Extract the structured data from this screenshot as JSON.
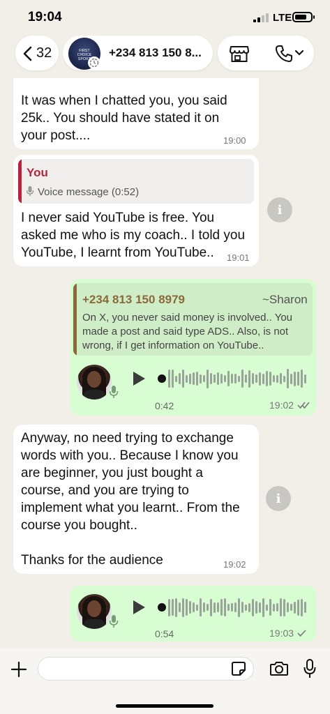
{
  "status": {
    "time": "19:04",
    "carrier": "LTE",
    "battery_level": 0.75
  },
  "header": {
    "back_count": "32",
    "contact_name": "+234 813 150 8...",
    "avatar_logo_text": "FIRST CHOICE SPORT"
  },
  "messages": [
    {
      "id": "m1",
      "direction": "incoming",
      "text": "It was when I chatted you, you said 25k.. You should have stated it on your post....",
      "lines": [
        "It was when I chatted you, you said",
        "25k.. You should have stated it on",
        "your post...."
      ],
      "time": "19:00"
    },
    {
      "id": "m2",
      "direction": "incoming",
      "quote": {
        "author": "You",
        "body": "Voice message (0:52)",
        "author_color": "#b5263c"
      },
      "lines": [
        "I never said YouTube is free. You",
        "asked me who is my coach.. I told you",
        "YouTube, I learnt from YouTube.."
      ],
      "time": "19:01"
    },
    {
      "id": "m3",
      "direction": "outgoing",
      "type": "voice",
      "quote": {
        "author": "+234 813 150 8979",
        "author_alias": "~Sharon",
        "author_color": "#8a6a3a",
        "lines": [
          "On X, you never said money is involved.. You",
          "made a post and said type ADS.. Also, is not",
          "wrong, if I get information on YouTube.."
        ]
      },
      "duration": "0:42",
      "time": "19:02",
      "status_icon": "double-check-icon"
    },
    {
      "id": "m4",
      "direction": "incoming",
      "lines": [
        "Anyway, no need trying to exchange",
        "words with you.. Because I know you",
        "are beginner, you just bought a",
        "course, and you are trying to",
        "implement what you learnt.. From the",
        "course you bought..",
        "",
        "Thanks for the audience"
      ],
      "time": "19:02"
    },
    {
      "id": "m5",
      "direction": "outgoing",
      "type": "voice",
      "duration": "0:54",
      "time": "19:03",
      "status_icon": "single-check-icon"
    }
  ],
  "composer": {
    "placeholder": "",
    "value": ""
  },
  "colors": {
    "background": "#f2efe8",
    "incoming": "#ffffff",
    "outgoing": "#d9fdd3",
    "quote_you": "#b5263c",
    "quote_other": "#8a6a3a"
  }
}
